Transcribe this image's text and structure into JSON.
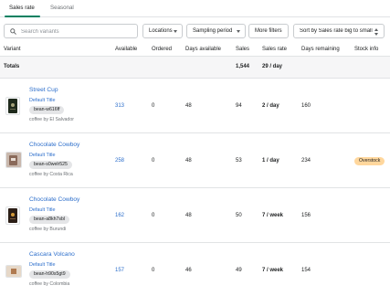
{
  "tabs": [
    {
      "label": "Sales rate",
      "active": true
    },
    {
      "label": "Seasonal",
      "active": false
    }
  ],
  "toolbar": {
    "search_placeholder": "Search variants",
    "locations_label": "Locations",
    "sampling_label": "Sampling period",
    "more_filters_label": "More filters",
    "sort_label": "Sort by Sales rate big to small"
  },
  "columns": {
    "variant": "Variant",
    "available": "Available",
    "ordered": "Ordered",
    "days_available": "Days available",
    "sales": "Sales",
    "sales_rate": "Sales rate",
    "days_remaining": "Days remaining",
    "stock_info": "Stock info"
  },
  "totals": {
    "label": "Totals",
    "sales": "1,544",
    "sales_rate": "29 / day"
  },
  "rows": [
    {
      "product": "Street Cup",
      "variant": "Default Title",
      "sku": "bean-w616ff",
      "vendor": "coffee by El Salvador",
      "available": "313",
      "ordered": "0",
      "days_available": "48",
      "sales": "94",
      "sales_rate": "2 / day",
      "days_remaining": "160",
      "stock_info": "",
      "thumb_color": "#1f2a1c"
    },
    {
      "product": "Chocolate Cowboy",
      "variant": "Default Title",
      "sku": "bean-s0welr525",
      "vendor": "coffee by Costa Rica",
      "available": "258",
      "ordered": "0",
      "days_available": "48",
      "sales": "53",
      "sales_rate": "1 / day",
      "days_remaining": "234",
      "stock_info": "Overstock",
      "thumb_color": "#8a6a5a"
    },
    {
      "product": "Chocolate Cowboy",
      "variant": "Default Title",
      "sku": "bean-a8kh7sbl",
      "vendor": "coffee by Burundi",
      "available": "162",
      "ordered": "0",
      "days_available": "48",
      "sales": "50",
      "sales_rate": "7 / week",
      "days_remaining": "156",
      "stock_info": "",
      "thumb_color": "#2b1e16"
    },
    {
      "product": "Cascara Volcano",
      "variant": "Default Title",
      "sku": "bean-h90s5gt9",
      "vendor": "coffee by Colombia",
      "available": "157",
      "ordered": "0",
      "days_available": "46",
      "sales": "49",
      "sales_rate": "7 / week",
      "days_remaining": "154",
      "stock_info": "",
      "thumb_color": "#e6d8c8"
    }
  ],
  "colors": {
    "accent": "#008060",
    "link": "#2c6ecb",
    "badge_overstock": "#ffd79d"
  }
}
